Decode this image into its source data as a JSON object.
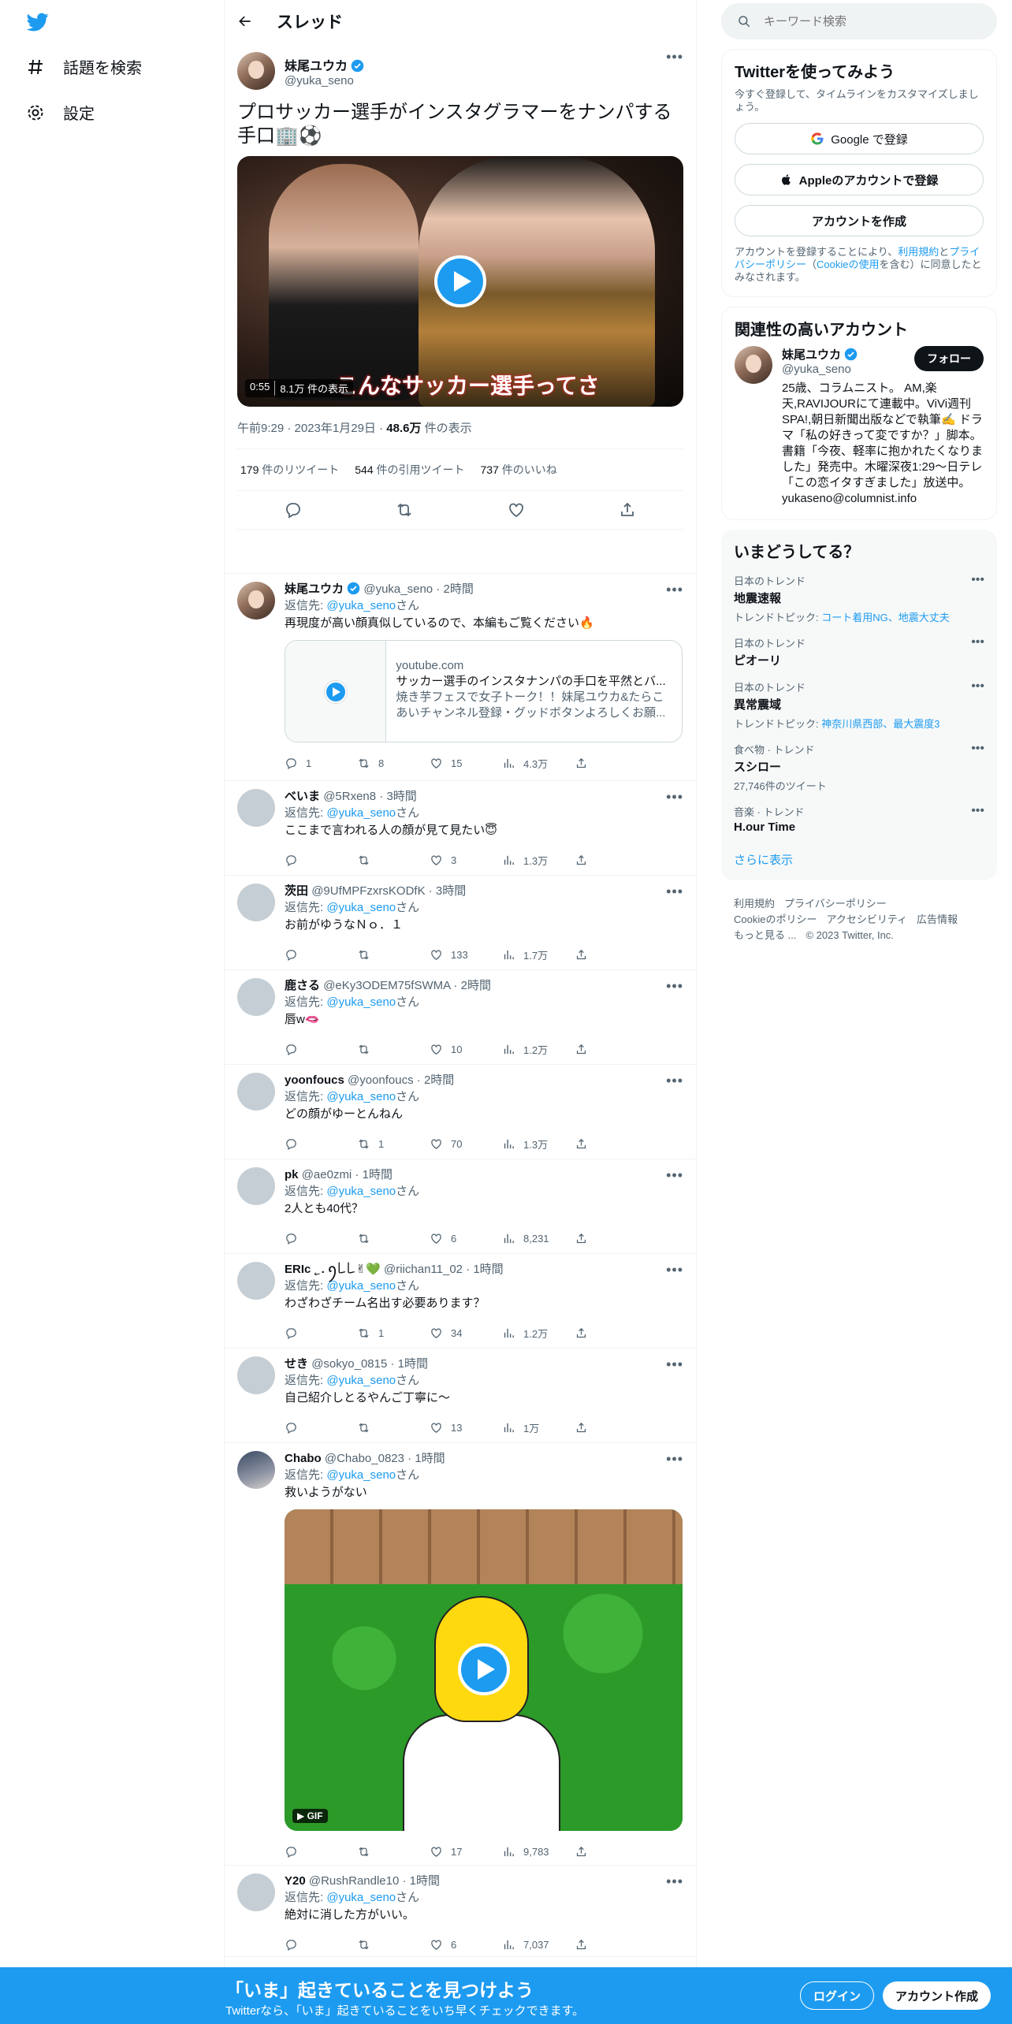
{
  "nav": {
    "items": [
      {
        "label": "話題を検索",
        "icon": "hashtag-icon"
      },
      {
        "label": "設定",
        "icon": "gear-icon"
      }
    ]
  },
  "thread": {
    "header": "スレッド",
    "main": {
      "name": "妹尾ユウカ",
      "handle": "@yuka_seno",
      "text": "プロサッカー選手がインスタグラマーをナンパする手口🏢⚽",
      "video_caption": "こんなサッカー選手ってさ",
      "video_time": "0:55",
      "video_views": "8.1万 件の表示",
      "time": "午前9:29 · 2023年1月29日 · ",
      "views_count": "48.6万",
      "views_label": " 件の表示",
      "retweets": "179",
      "retweets_label": " 件のリツイート",
      "quotes": "544",
      "quotes_label": " 件の引用ツイート",
      "likes": "737",
      "likes_label": " 件のいいね"
    },
    "replies": [
      {
        "name": "妹尾ユウカ",
        "handle": "@yuka_seno · 2時間",
        "replyto_prefix": "返信先: ",
        "replyto": "@yuka_seno",
        "replyto_suffix": "さん",
        "text": "再現度が高い顔真似しているので、本編もご覧ください🔥",
        "card": {
          "domain": "youtube.com",
          "title": "サッカー選手のインスタナンパの手口を平然とバ...",
          "desc": "焼き芋フェスで女子トーク！！妹尾ユウカ&たらこあいチャンネル登録・グッドボタンよろしくお願..."
        },
        "replies": "1",
        "retweets": "8",
        "likes": "15",
        "views": "4.3万"
      },
      {
        "name": "べいま",
        "handle": "@5Rxen8 · 3時間",
        "replyto_prefix": "返信先: ",
        "replyto": "@yuka_seno",
        "replyto_suffix": "さん",
        "text": "ここまで言われる人の顔が見て見たい😇",
        "replies": "",
        "retweets": "",
        "likes": "3",
        "views": "1.3万"
      },
      {
        "name": "茨田",
        "handle": "@9UfMPFzxrsKODfK · 3時間",
        "replyto_prefix": "返信先: ",
        "replyto": "@yuka_seno",
        "replyto_suffix": "さん",
        "text": "お前がゆうなＮｏ．１",
        "replies": "",
        "retweets": "",
        "likes": "133",
        "views": "1.7万"
      },
      {
        "name": "鹿さる",
        "handle": "@eKy3ODEM75fSWMA · 2時間",
        "replyto_prefix": "返信先: ",
        "replyto": "@yuka_seno",
        "replyto_suffix": "さん",
        "text": "唇w🫦",
        "replies": "",
        "retweets": "",
        "likes": "10",
        "views": "1.2万"
      },
      {
        "name": "yoonfoucs",
        "handle": "@yoonfoucs · 2時間",
        "replyto_prefix": "返信先: ",
        "replyto": "@yuka_seno",
        "replyto_suffix": "さん",
        "text": "どの顔がゆーとんねん",
        "replies": "",
        "retweets": "1",
        "likes": "70",
        "views": "1.3万"
      },
      {
        "name": "pk",
        "handle": "@ae0zmi · 1時間",
        "replyto_prefix": "返信先: ",
        "replyto": "@yuka_seno",
        "replyto_suffix": "さん",
        "text": "2人とも40代？",
        "replies": "",
        "retweets": "",
        "likes": "6",
        "views": "8,231"
      },
      {
        "name": "ERIc ˛̼ . ꪆ꒒꒒✌💚",
        "handle": "@riichan11_02 · 1時間",
        "replyto_prefix": "返信先: ",
        "replyto": "@yuka_seno",
        "replyto_suffix": "さん",
        "text": "わざわざチーム名出す必要あります？",
        "replies": "",
        "retweets": "1",
        "likes": "34",
        "views": "1.2万"
      },
      {
        "name": "せき",
        "handle": "@sokyo_0815 · 1時間",
        "replyto_prefix": "返信先: ",
        "replyto": "@yuka_seno",
        "replyto_suffix": "さん",
        "text": "自己紹介しとるやんご丁寧に〜",
        "replies": "",
        "retweets": "",
        "likes": "13",
        "views": "1万"
      },
      {
        "name": "Chabo",
        "handle": "@Chabo_0823 · 1時間",
        "replyto_prefix": "返信先: ",
        "replyto": "@yuka_seno",
        "replyto_suffix": "さん",
        "text": "救いようがない",
        "gif_label": "GIF",
        "replies": "",
        "retweets": "",
        "likes": "17",
        "views": "9,783"
      },
      {
        "name": "Y20",
        "handle": "@RushRandle10 · 1時間",
        "replyto_prefix": "返信先: ",
        "replyto": "@yuka_seno",
        "replyto_suffix": "さん",
        "text": "絶対に消した方がいい。",
        "replies": "",
        "retweets": "",
        "likes": "6",
        "views": "7,037"
      }
    ]
  },
  "sidebar": {
    "search_placeholder": "キーワード検索",
    "signup": {
      "title": "Twitterを使ってみよう",
      "sub": "今すぐ登録して、タイムラインをカスタマイズしましょう。",
      "google": "Google で登録",
      "apple": "Appleのアカウントで登録",
      "create": "アカウントを作成",
      "legal_1": "アカウントを登録することにより、",
      "legal_terms": "利用規約",
      "legal_2": "と",
      "legal_privacy": "プライバシーポリシー",
      "legal_3": "（",
      "legal_cookie": "Cookieの使用",
      "legal_4": "を含む）に同意したとみなされます。"
    },
    "related": {
      "title": "関連性の高いアカウント",
      "name": "妹尾ユウカ",
      "handle": "@yuka_seno",
      "follow": "フォロー",
      "bio": "25歳、コラムニスト。 AM,楽天,RAVIJOURにて連載中。ViVi週刊SPA!,朝日新聞出版などで執筆✍️ ドラマ「私の好きって変ですか？」脚本。書籍「今夜、軽率に抱かれたくなりました」発売中。木曜深夜1:29〜日テレ「この恋イタすぎました」放送中。yukaseno@columnist.info"
    },
    "trends": {
      "title": "いまどうしてる？",
      "items": [
        {
          "cat": "日本のトレンド",
          "name": "地震速報",
          "meta_prefix": "トレンドトピック: ",
          "meta_link": "コート着用NG、地震大丈夫"
        },
        {
          "cat": "日本のトレンド",
          "name": "ピオーリ",
          "meta_prefix": "",
          "meta_link": ""
        },
        {
          "cat": "日本のトレンド",
          "name": "異常震域",
          "meta_prefix": "トレンドトピック: ",
          "meta_link": "神奈川県西部、最大震度3"
        },
        {
          "cat": "食べ物 · トレンド",
          "name": "スシロー",
          "meta_prefix": "27,746件のツイート",
          "meta_link": ""
        },
        {
          "cat": "音楽 · トレンド",
          "name": "H.our Time",
          "meta_prefix": "",
          "meta_link": ""
        }
      ],
      "show_more": "さらに表示"
    },
    "footer": {
      "terms": "利用規約",
      "privacy": "プライバシーポリシー",
      "cookie": "Cookieのポリシー",
      "accessibility": "アクセシビリティ",
      "ads": "広告情報",
      "more": "もっと見る ...",
      "copyright": "© 2023 Twitter, Inc."
    }
  },
  "bottom": {
    "headline": "「いま」起きていることを見つけよう",
    "sub": "Twitterなら、「いま」起きていることをいち早くチェックできます。",
    "login": "ログイン",
    "signup": "アカウント作成"
  },
  "colors": {
    "accent": "#1d9bf0",
    "text": "#0f1419",
    "muted": "#536471"
  }
}
